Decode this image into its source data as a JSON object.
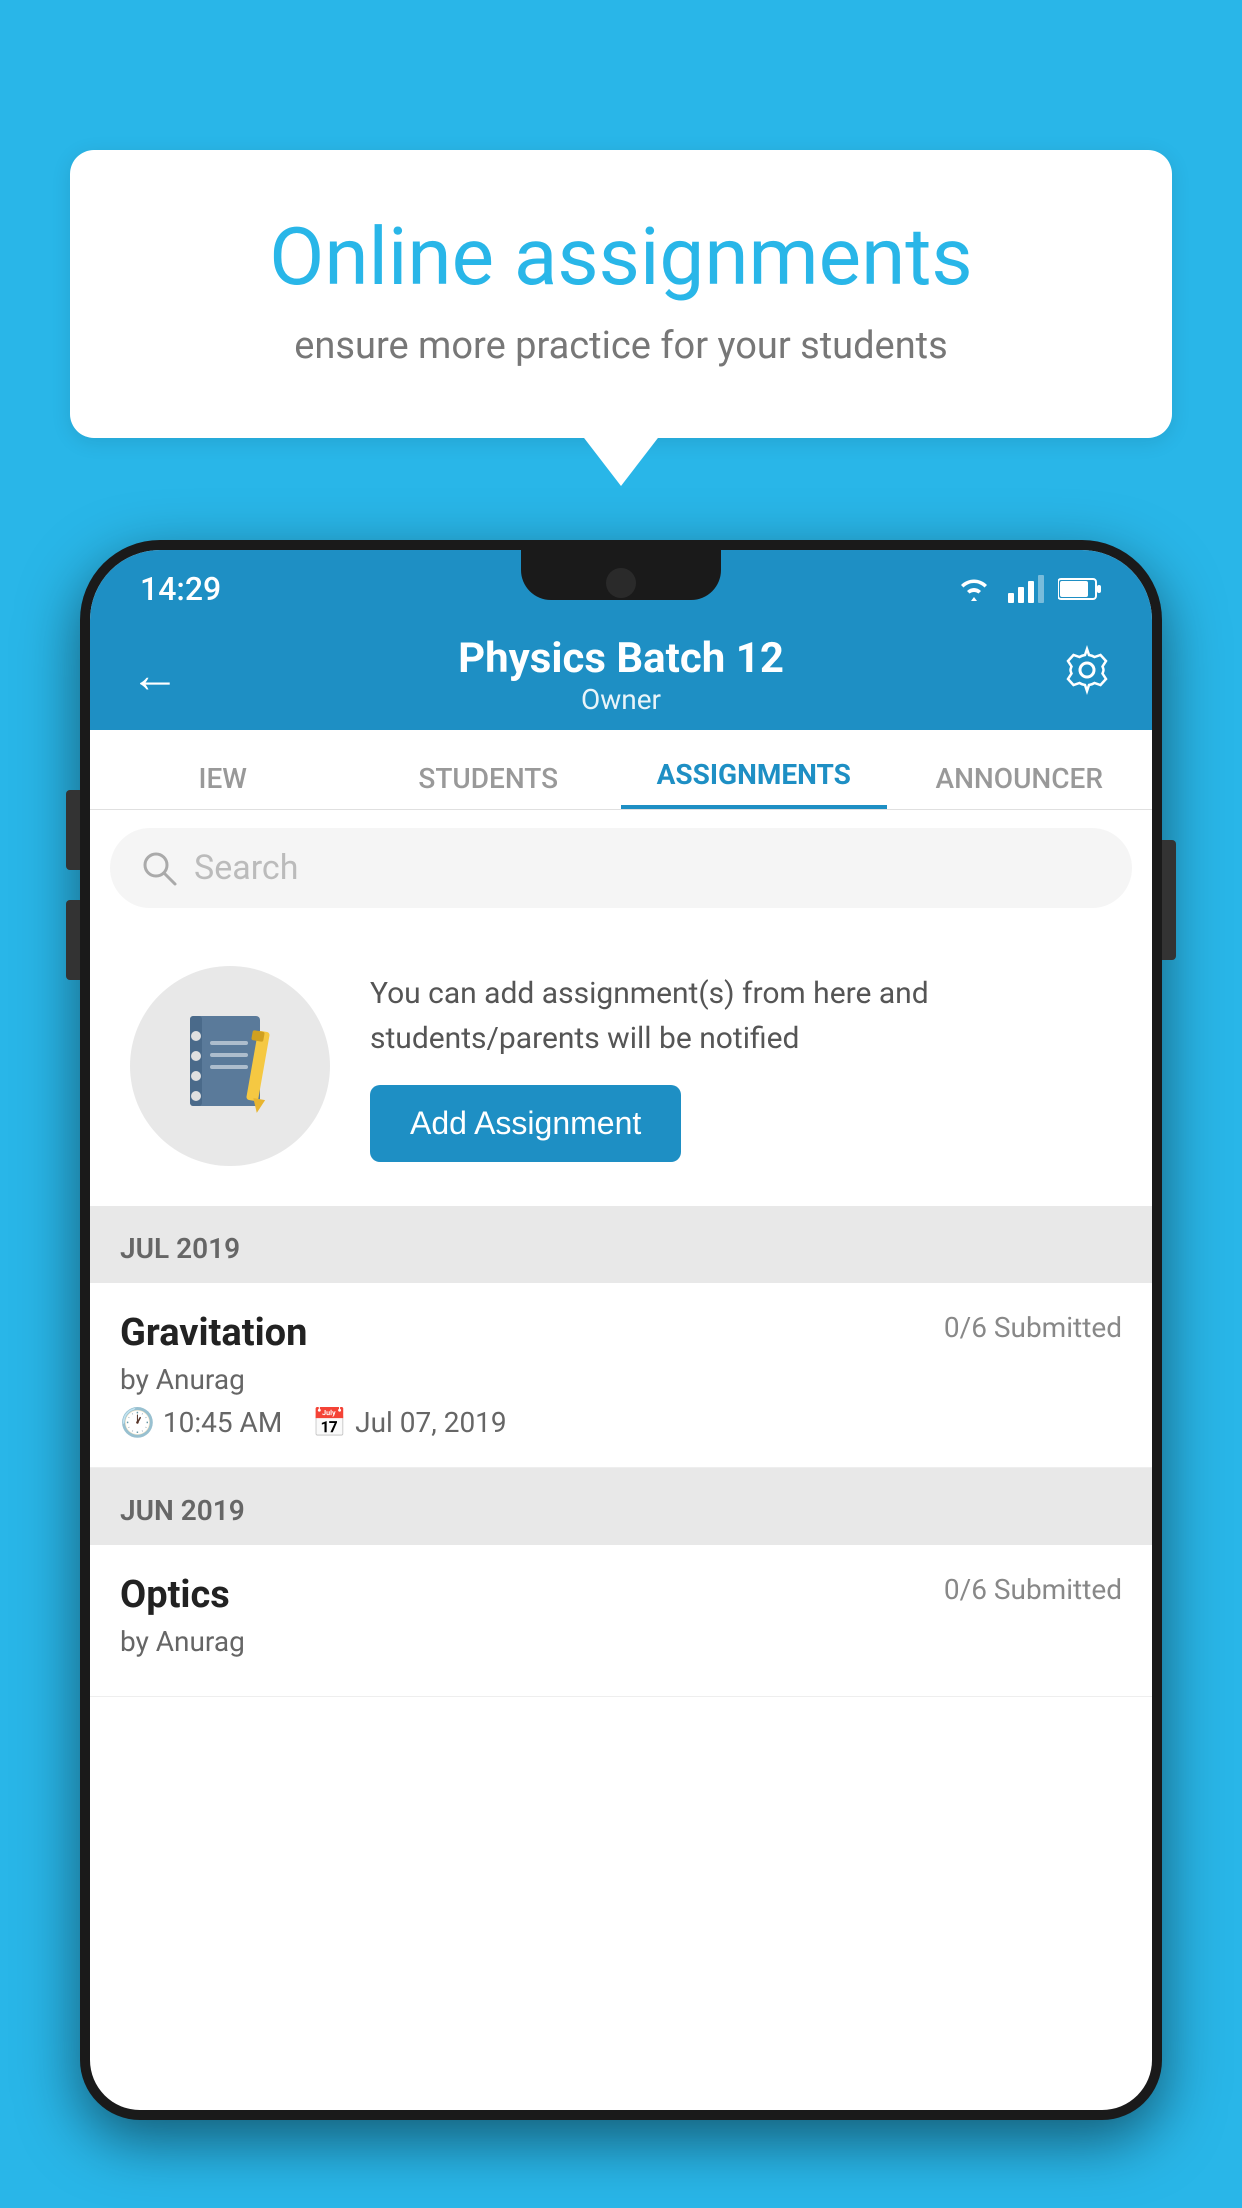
{
  "background_color": "#29b6e8",
  "speech_bubble": {
    "title": "Online assignments",
    "subtitle": "ensure more practice for your students"
  },
  "phone": {
    "status_bar": {
      "time": "14:29"
    },
    "top_bar": {
      "title": "Physics Batch 12",
      "subtitle": "Owner",
      "back_label": "←",
      "settings_label": "⚙"
    },
    "tabs": [
      {
        "label": "IEW",
        "active": false
      },
      {
        "label": "STUDENTS",
        "active": false
      },
      {
        "label": "ASSIGNMENTS",
        "active": true
      },
      {
        "label": "ANNOUNCER",
        "active": false
      }
    ],
    "search": {
      "placeholder": "Search"
    },
    "empty_state": {
      "description": "You can add assignment(s) from here and students/parents will be notified",
      "button_label": "Add Assignment"
    },
    "sections": [
      {
        "header": "JUL 2019",
        "assignments": [
          {
            "title": "Gravitation",
            "submitted": "0/6 Submitted",
            "by": "by Anurag",
            "time": "10:45 AM",
            "date": "Jul 07, 2019"
          }
        ]
      },
      {
        "header": "JUN 2019",
        "assignments": [
          {
            "title": "Optics",
            "submitted": "0/6 Submitted",
            "by": "by Anurag",
            "time": "",
            "date": ""
          }
        ]
      }
    ]
  }
}
